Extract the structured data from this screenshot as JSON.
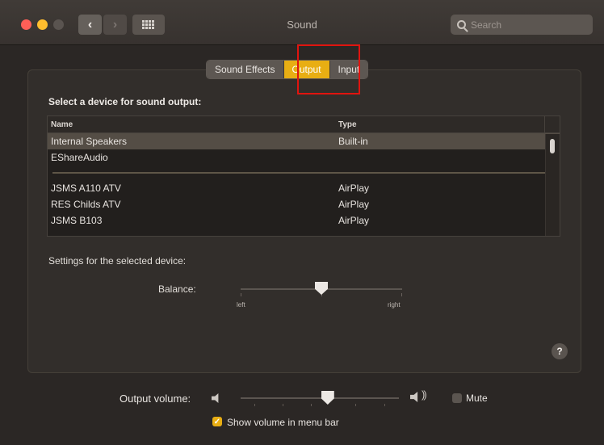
{
  "window": {
    "title": "Sound",
    "search_placeholder": "Search",
    "icons": {
      "back": "chevron-left-icon",
      "forward": "chevron-right-icon",
      "grid": "grid-icon",
      "search": "search-icon"
    }
  },
  "tabs": [
    {
      "label": "Sound Effects",
      "active": false
    },
    {
      "label": "Output",
      "active": true
    },
    {
      "label": "Input",
      "active": false
    }
  ],
  "output": {
    "section_title": "Select a device for sound output:",
    "columns": {
      "name": "Name",
      "type": "Type"
    },
    "devices_primary": [
      {
        "name": "Internal Speakers",
        "type": "Built-in",
        "selected": true
      },
      {
        "name": "EShareAudio",
        "type": "",
        "selected": false
      }
    ],
    "devices_airplay": [
      {
        "name": "JSMS A110 ATV",
        "type": "AirPlay"
      },
      {
        "name": "RES Childs ATV",
        "type": "AirPlay"
      },
      {
        "name": "JSMS B103",
        "type": "AirPlay"
      }
    ],
    "settings_label": "Settings for the selected device:",
    "balance": {
      "label": "Balance:",
      "left": "left",
      "right": "right",
      "value": 0.5
    }
  },
  "help_label": "?",
  "volume": {
    "label": "Output volume:",
    "value": 0.55,
    "mute_label": "Mute",
    "muted": false,
    "show_in_menu_bar_label": "Show volume in menu bar",
    "show_in_menu_bar": true,
    "waves": "))"
  },
  "colors": {
    "accent": "#e8ae13",
    "highlight": "#e0140f",
    "background": "#2b2725"
  }
}
